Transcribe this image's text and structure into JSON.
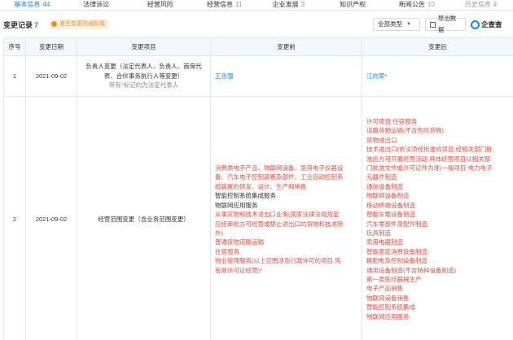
{
  "tabs": [
    {
      "label": "基本信息",
      "count": "44",
      "state": "active"
    },
    {
      "label": "法律诉讼",
      "count": "",
      "state": "normal"
    },
    {
      "label": "经营风险",
      "count": "",
      "state": "normal"
    },
    {
      "label": "经营信息",
      "count": "11",
      "state": "normal"
    },
    {
      "label": "企业发展",
      "count": "3",
      "state": "normal"
    },
    {
      "label": "知识产权",
      "count": "",
      "state": "normal"
    },
    {
      "label": "新闻公告",
      "count": "10",
      "state": "normal"
    },
    {
      "label": "历史信息",
      "count": "4",
      "state": "faded"
    }
  ],
  "section": {
    "title": "变更记录",
    "count": "7",
    "notice": "发生变更时通知我",
    "type_button": "全部类型",
    "export_button": "导出数据",
    "logo_text": "企查查"
  },
  "table": {
    "headers": [
      "序号",
      "变更日期",
      "变更项目",
      "变更前",
      "变更后"
    ],
    "rows": [
      {
        "index": "1",
        "date": "2021-09-02",
        "item": "负责人变更（法定代表人、负责人、首席代表、合伙事务执行人等变更）",
        "item_note": "带有*标记的为法定代表人",
        "before": "王念强",
        "after": "江向荣*"
      },
      {
        "index": "2",
        "date": "2021-09-02",
        "item": "经营范围变更（含业务范围变更）",
        "before_lines": [
          "消费类电子产品、物联网设备、医用电子仪器设",
          "备、汽车电子控制装置及部件、工业自动控制系",
          "统装置的研发、设计、生产和销售",
          "智能控制系统集成服务",
          "物联网应用服务",
          "从事货物和技术进出口业务(国家法律法规规定",
          "应经审批方可经营或禁止进出口的货物和技术除",
          "外)",
          "普通货物道路运输",
          "住宿服务",
          "物业管理服务(以上范围涉及行政许可的项目,凭",
          "有效许可证经营)*"
        ],
        "after_lines": [
          "许可项目:住宿服务",
          "道路货物运输(不含危险货物)",
          "货物进出口",
          "技术进出口(依法须经批准的项目,经相关部门批",
          "准后方可开展经营活动,具体经营项目以相关部",
          "门批准文件或许可证件为准)一般项目:电力电子",
          "元器件制造",
          "通信设备制造",
          "物联网设备制造",
          "移动终端设备制造",
          "智能车载设备制造",
          "汽车零部件及配件制造",
          "玩具制造",
          "家用电器制造",
          "智能家庭消费设备制造",
          "輸配电及控制设备制造",
          "通用设备制造(不含特种设备制造)",
          "第一类医疗器械生产",
          "电子产品销售",
          "物联网设备销售",
          "智能控制系统集成",
          "物联网应用服务"
        ]
      }
    ]
  },
  "colors": {
    "accent": "#128bed",
    "changed_text": "#e64b3a",
    "notice_bg": "#fdf1e2",
    "notice_text": "#fa8c16",
    "header_bg": "#f2f8fe"
  }
}
